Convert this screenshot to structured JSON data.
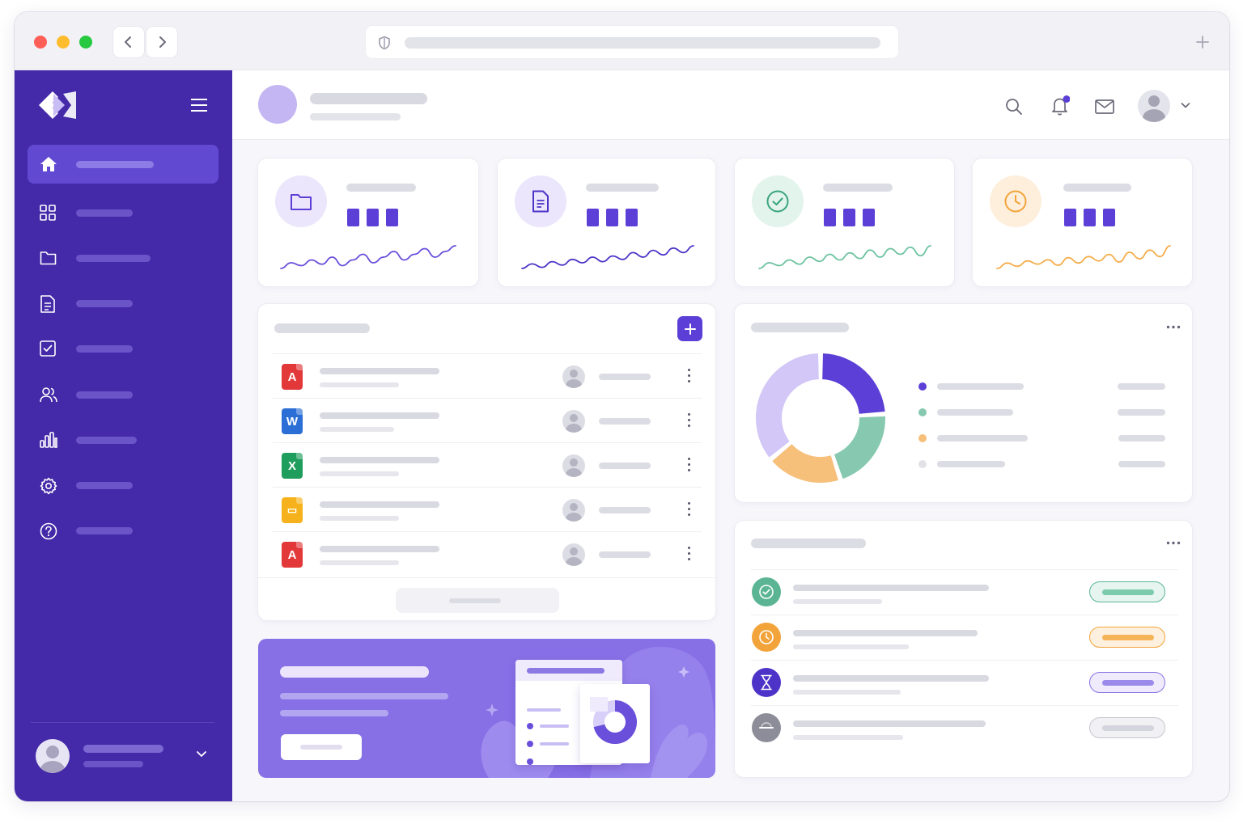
{
  "window": {
    "traffic_lights": [
      "#ff5f57",
      "#febc2e",
      "#28c840"
    ],
    "nav": {
      "back_icon": "chevron-left-icon",
      "forward_icon": "chevron-right-icon"
    },
    "address_bar": {
      "icon": "shield-icon",
      "url": ""
    },
    "new_tab_icon": "plus-icon"
  },
  "colors": {
    "sidebar": "#4429a8",
    "accent": "#5b3fd6",
    "green": "#5bb594",
    "orange": "#f2a43a",
    "light_purple": "#c9bdf5"
  },
  "sidebar": {
    "logo_icon": "logo-icon",
    "menu_icon": "hamburger-icon",
    "items": [
      {
        "icon": "home-icon",
        "label": "",
        "active": true
      },
      {
        "icon": "grid-icon",
        "label": ""
      },
      {
        "icon": "folder-icon",
        "label": ""
      },
      {
        "icon": "document-icon",
        "label": ""
      },
      {
        "icon": "checkbox-icon",
        "label": ""
      },
      {
        "icon": "users-icon",
        "label": ""
      },
      {
        "icon": "bar-chart-icon",
        "label": ""
      },
      {
        "icon": "gear-icon",
        "label": ""
      },
      {
        "icon": "help-icon",
        "label": ""
      }
    ],
    "user": {
      "name": "",
      "role": "",
      "expand_icon": "chevron-down-icon"
    }
  },
  "header": {
    "title": "",
    "subtitle": "",
    "icons": [
      "search-icon",
      "bell-icon",
      "mail-icon"
    ],
    "notification_badge_color": "#5b3fd6",
    "user_menu_icon": "chevron-down-icon"
  },
  "stats": [
    {
      "icon": "folder-icon",
      "color": "#5b3fd6",
      "bg": "#ebe6fb",
      "label": "",
      "value": "",
      "trend": [
        6,
        10,
        8,
        12,
        9,
        14,
        8,
        12,
        16,
        10,
        14,
        18,
        12,
        16,
        20,
        14,
        18,
        22
      ]
    },
    {
      "icon": "document-icon",
      "color": "#4d33c7",
      "bg": "#ebe6fb",
      "label": "",
      "value": "",
      "trend": [
        4,
        8,
        5,
        10,
        7,
        12,
        9,
        14,
        10,
        15,
        12,
        18,
        14,
        20,
        16,
        22,
        18,
        24
      ]
    },
    {
      "icon": "check-circle-icon",
      "color": "#3aa57c",
      "bg": "#e3f4ed",
      "label": "",
      "value": "",
      "trend": [
        5,
        9,
        7,
        11,
        8,
        13,
        10,
        15,
        11,
        16,
        12,
        18,
        13,
        19,
        15,
        20,
        14,
        21
      ]
    },
    {
      "icon": "clock-icon",
      "color": "#f2a43a",
      "bg": "#fdefdc",
      "label": "",
      "value": "",
      "trend": [
        5,
        10,
        7,
        12,
        9,
        13,
        8,
        15,
        10,
        16,
        12,
        18,
        11,
        20,
        14,
        22,
        16,
        26
      ]
    }
  ],
  "files": {
    "title": "",
    "add_icon": "plus-icon",
    "view_all_label": "",
    "rows": [
      {
        "type": "pdf",
        "icon": "pdf-file-icon",
        "color": "#e2383a",
        "glyph": "A",
        "name": "",
        "meta": "",
        "owner": ""
      },
      {
        "type": "word",
        "icon": "word-file-icon",
        "color": "#2b6fd6",
        "glyph": "W",
        "name": "",
        "meta": "",
        "owner": ""
      },
      {
        "type": "excel",
        "icon": "excel-file-icon",
        "color": "#1f9d5c",
        "glyph": "X",
        "name": "",
        "meta": "",
        "owner": ""
      },
      {
        "type": "folder",
        "icon": "folder-file-icon",
        "color": "#f6b21c",
        "glyph": "▭",
        "name": "",
        "meta": "",
        "owner": ""
      },
      {
        "type": "pdf",
        "icon": "pdf-file-icon",
        "color": "#e2383a",
        "glyph": "A",
        "name": "",
        "meta": "",
        "owner": ""
      }
    ]
  },
  "donut": {
    "title": "",
    "more_icon": "more-horizontal-icon",
    "segments": [
      {
        "label": "",
        "value": 24,
        "color": "#5b3fd6"
      },
      {
        "label": "",
        "value": 21,
        "color": "#86c9b0"
      },
      {
        "label": "",
        "value": 19,
        "color": "#f6bf7a"
      },
      {
        "label": "",
        "value": 36,
        "color": "#d2c7f6"
      }
    ],
    "legend_values": [
      "",
      "",
      "",
      ""
    ]
  },
  "banner": {
    "title": "",
    "text_line1": "",
    "text_line2": "",
    "button_label": ""
  },
  "tasks": {
    "title": "",
    "more_icon": "more-horizontal-icon",
    "rows": [
      {
        "icon": "check-circle-icon",
        "circle": "#5bb594",
        "pill_bg": "#e6f5ef",
        "pill_border": "#5bb594",
        "pill_fill": "#7ccbad",
        "title": "",
        "sub": "",
        "status": ""
      },
      {
        "icon": "clock-icon",
        "circle": "#f2a43a",
        "pill_bg": "#fdf0de",
        "pill_border": "#f2a43a",
        "pill_fill": "#f6b45a",
        "title": "",
        "sub": "",
        "status": ""
      },
      {
        "icon": "hourglass-icon",
        "circle": "#4d33c7",
        "pill_bg": "#efebfc",
        "pill_border": "#8a74e6",
        "pill_fill": "#9c8aea",
        "title": "",
        "sub": "",
        "status": ""
      },
      {
        "icon": "minus-circle-icon",
        "circle": "#8d8d9a",
        "pill_bg": "#f1f1f4",
        "pill_border": "#c5c5cf",
        "pill_fill": "#d4d4dc",
        "title": "",
        "sub": "",
        "status": ""
      }
    ]
  }
}
